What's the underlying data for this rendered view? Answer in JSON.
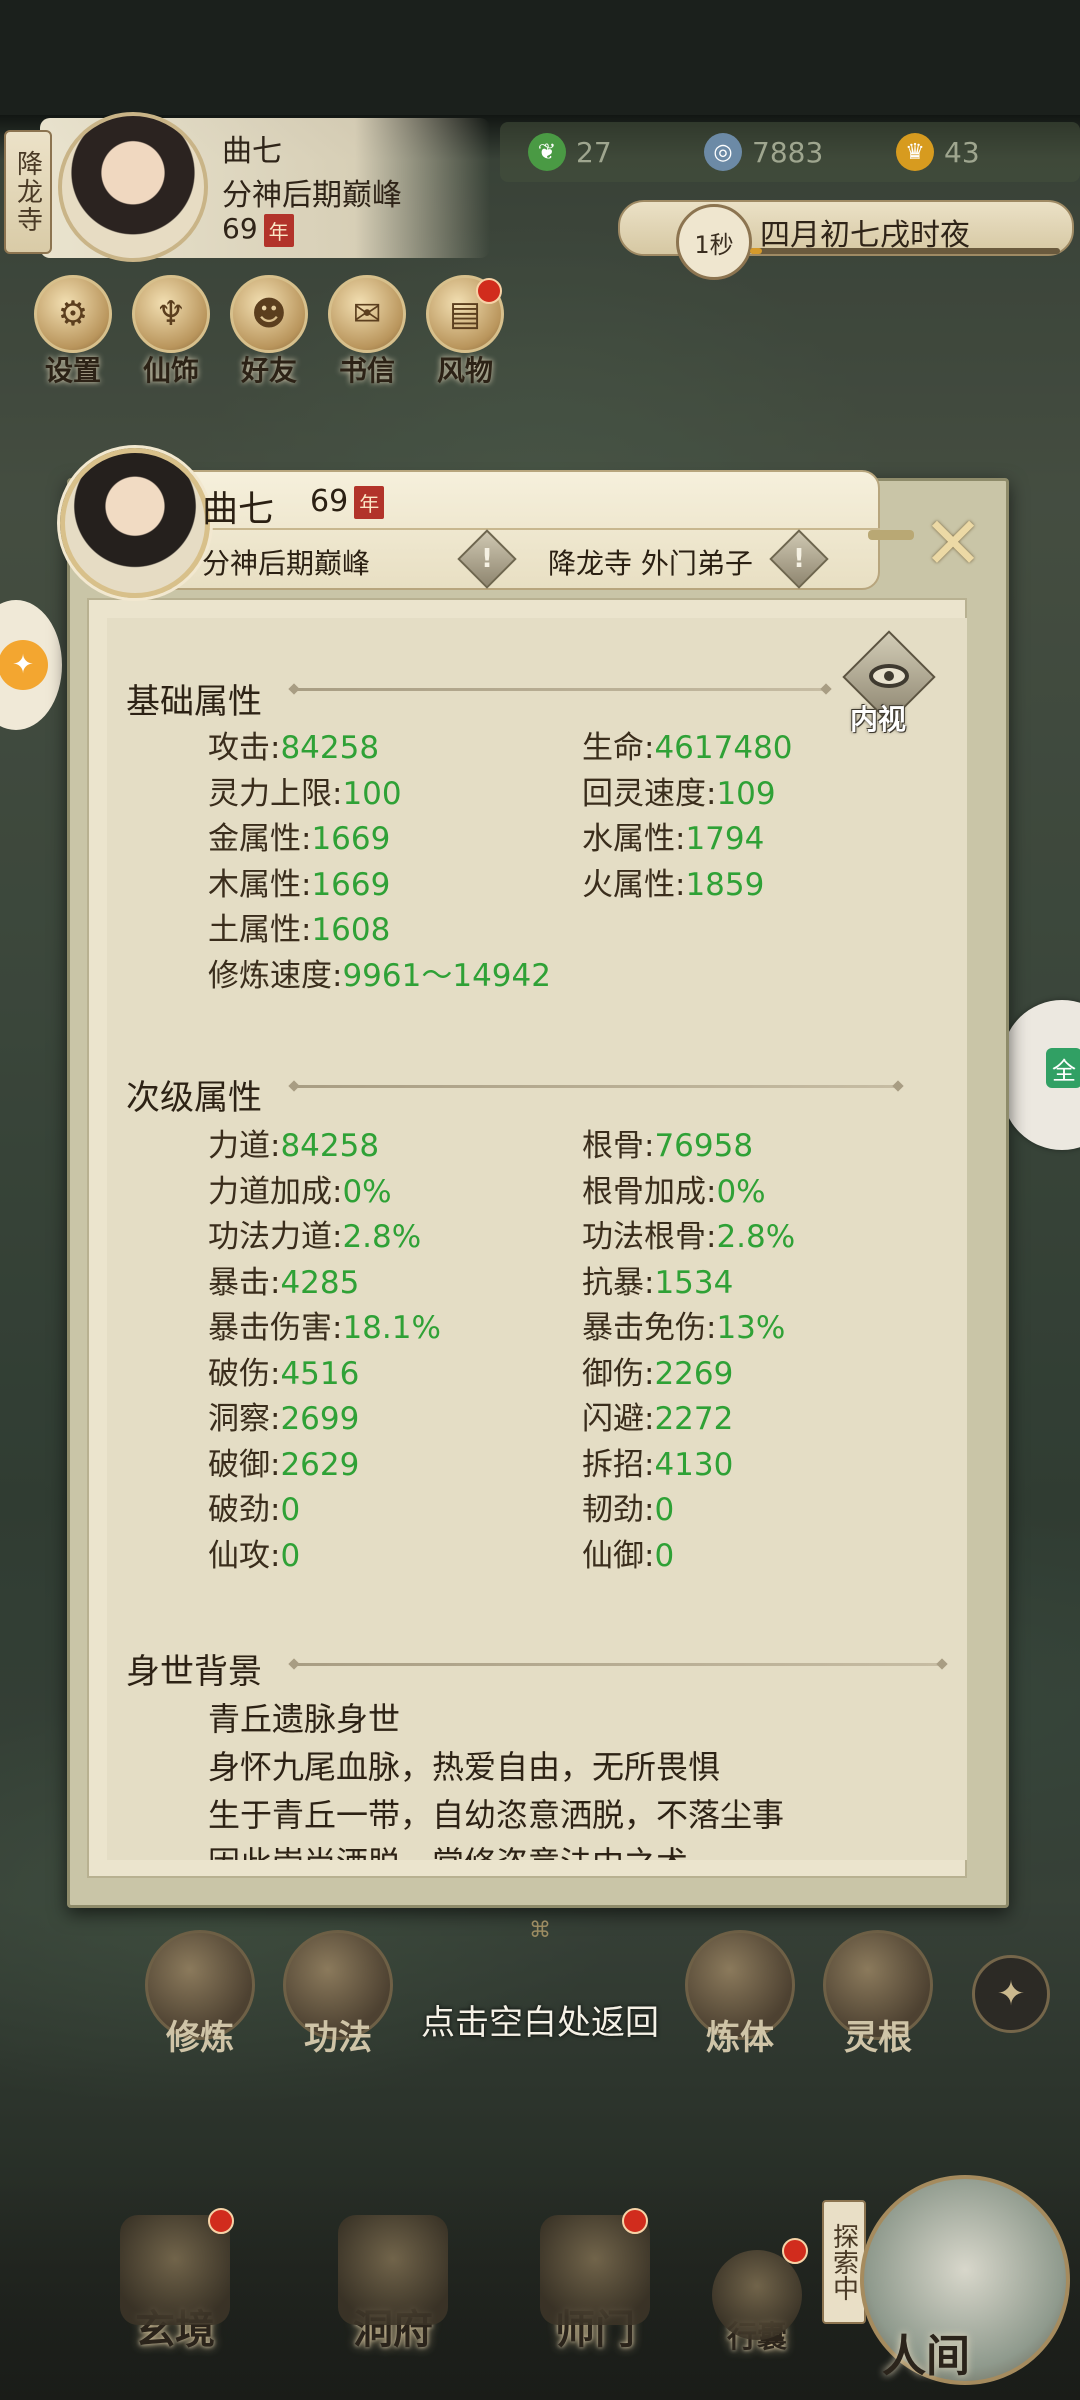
{
  "hud": {
    "sect_tag": "降龙寺",
    "name": "曲七",
    "realm": "分神后期巅峰",
    "age": "69",
    "year_tag": "年",
    "resources": [
      {
        "value": "27",
        "icon": "jade-leaf-icon",
        "color": "#4a9a44"
      },
      {
        "value": "7883",
        "icon": "coin-icon",
        "color": "#6c8aa6"
      },
      {
        "value": "43",
        "icon": "gold-ingot-icon",
        "color": "#d79b1f"
      }
    ],
    "time_badge": "1秒",
    "time_text": "四月初七戌时夜",
    "time_progress": 0.04,
    "top_buttons": [
      {
        "label": "设置",
        "icon": "settings-icon"
      },
      {
        "label": "仙饰",
        "icon": "costume-icon"
      },
      {
        "label": "好友",
        "icon": "friends-icon"
      },
      {
        "label": "书信",
        "icon": "letter-icon"
      },
      {
        "label": "风物",
        "icon": "scenery-icon"
      }
    ]
  },
  "panel": {
    "name": "曲七",
    "age": "69",
    "year_tag": "年",
    "realm": "分神后期巅峰",
    "sect": "降龙寺 外门弟子",
    "warn_glyph": "!",
    "close_glyph": "✕",
    "inner_view_label": "内视",
    "sections": {
      "basic": {
        "title": "基础属性",
        "left": [
          {
            "label": "攻击:",
            "value": "84258"
          },
          {
            "label": "灵力上限:",
            "value": "100"
          },
          {
            "label": "金属性:",
            "value": "1669"
          },
          {
            "label": "木属性:",
            "value": "1669"
          },
          {
            "label": "土属性:",
            "value": "1608"
          },
          {
            "label": "修炼速度:",
            "value": "9961～14942"
          }
        ],
        "right": [
          {
            "label": "生命:",
            "value": "4617480"
          },
          {
            "label": "回灵速度:",
            "value": "109"
          },
          {
            "label": "水属性:",
            "value": "1794"
          },
          {
            "label": "火属性:",
            "value": "1859"
          }
        ]
      },
      "secondary": {
        "title": "次级属性",
        "left": [
          {
            "label": "力道:",
            "value": "84258"
          },
          {
            "label": "力道加成:",
            "value": "0%"
          },
          {
            "label": "功法力道:",
            "value": "2.8%"
          },
          {
            "label": "暴击:",
            "value": "4285"
          },
          {
            "label": "暴击伤害:",
            "value": "18.1%"
          },
          {
            "label": "破伤:",
            "value": "4516"
          },
          {
            "label": "洞察:",
            "value": "2699"
          },
          {
            "label": "破御:",
            "value": "2629"
          },
          {
            "label": "破劲:",
            "value": "0"
          },
          {
            "label": "仙攻:",
            "value": "0"
          }
        ],
        "right": [
          {
            "label": "根骨:",
            "value": "76958"
          },
          {
            "label": "根骨加成:",
            "value": "0%"
          },
          {
            "label": "功法根骨:",
            "value": "2.8%"
          },
          {
            "label": "抗暴:",
            "value": "1534"
          },
          {
            "label": "暴击免伤:",
            "value": "13%"
          },
          {
            "label": "御伤:",
            "value": "2269"
          },
          {
            "label": "闪避:",
            "value": "2272"
          },
          {
            "label": "拆招:",
            "value": "4130"
          },
          {
            "label": "韧劲:",
            "value": "0"
          },
          {
            "label": "仙御:",
            "value": "0"
          }
        ]
      },
      "background": {
        "title": "身世背景",
        "lines": [
          "青丘遗脉身世",
          "身怀九尾血脉，热爱自由，无所畏惧",
          "生于青丘一带，自幼恣意洒脱，不落尘事",
          "因此崇尚洒脱，常修恣意法中之术"
        ]
      }
    }
  },
  "feature_row": [
    {
      "label": "修炼"
    },
    {
      "label": "功法"
    },
    {
      "label": "炼体"
    },
    {
      "label": "灵根"
    }
  ],
  "return_hint": "点击空白处返回",
  "bottom_nav": [
    {
      "label": "玄境"
    },
    {
      "label": "洞府"
    },
    {
      "label": "师门"
    },
    {
      "label": "行囊"
    }
  ],
  "explore_tag": "探索中",
  "world_label": "人间",
  "side_right_glyph": "全",
  "colors": {
    "stat_value": "#2fa136",
    "panel_bg": "#e4ddc5",
    "year_tag": "#b2332a",
    "red_dot": "#d12c1d"
  }
}
